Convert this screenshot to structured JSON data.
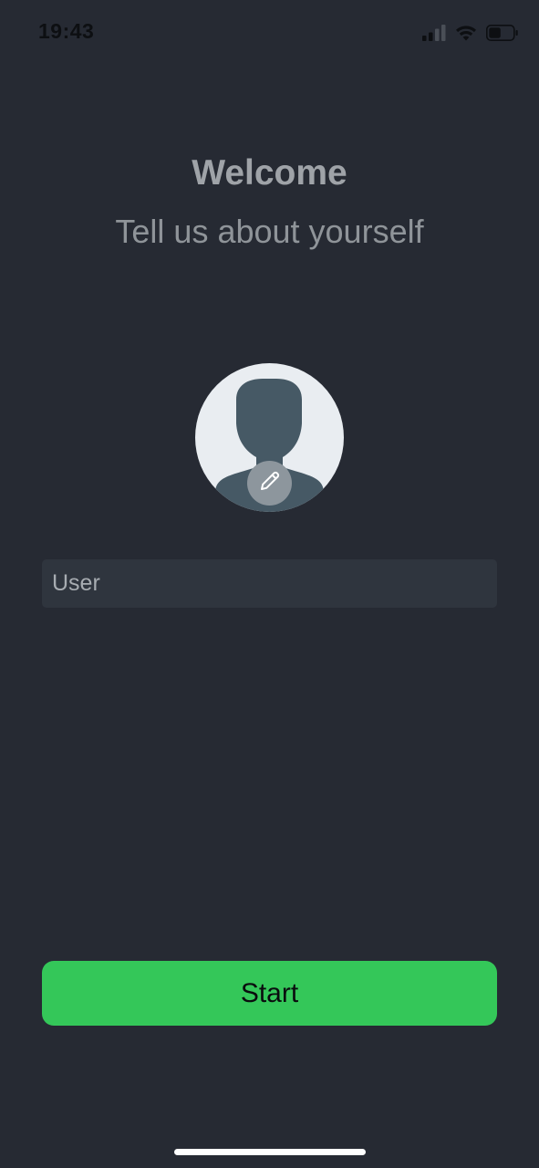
{
  "status_bar": {
    "time": "19:43",
    "icons": [
      "cellular-signal-icon",
      "wifi-icon",
      "battery-icon"
    ],
    "battery_level": 0.5
  },
  "header": {
    "title": "Welcome",
    "subtitle": "Tell us about yourself"
  },
  "profile": {
    "avatar": "person-silhouette-icon",
    "edit_icon": "pencil-icon"
  },
  "form": {
    "name_value": "User"
  },
  "actions": {
    "start_label": "Start"
  },
  "colors": {
    "background": "#262a33",
    "accent": "#34c759",
    "field_background": "#2f353e",
    "avatar_background": "#e9edf1",
    "silhouette": "#465965"
  }
}
